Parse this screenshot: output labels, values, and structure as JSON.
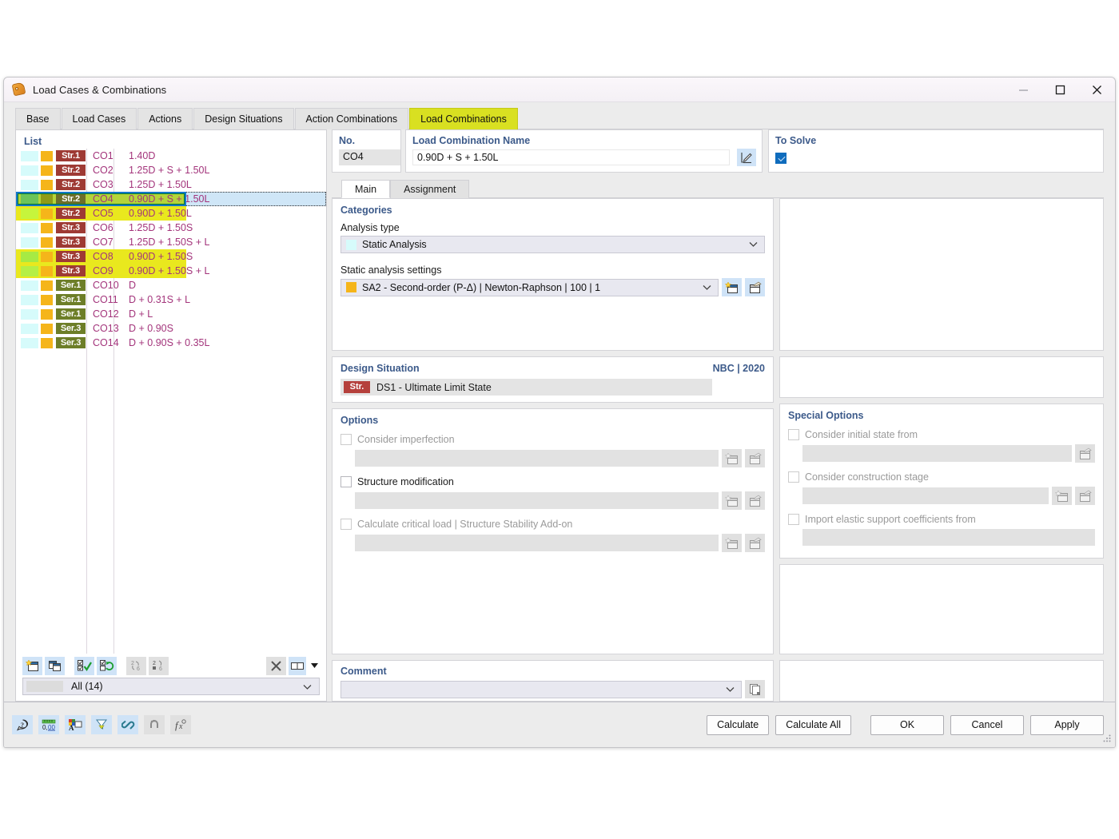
{
  "window": {
    "title": "Load Cases & Combinations",
    "icon": "load-tag-icon",
    "controls": {
      "minimize": "minimize-icon",
      "maximize": "maximize-icon",
      "close": "close-icon"
    }
  },
  "tabs": [
    {
      "label": "Base",
      "active": false
    },
    {
      "label": "Load Cases",
      "active": false
    },
    {
      "label": "Actions",
      "active": false
    },
    {
      "label": "Design Situations",
      "active": false
    },
    {
      "label": "Action Combinations",
      "active": false
    },
    {
      "label": "Load Combinations",
      "active": true
    }
  ],
  "list": {
    "title": "List",
    "rows": [
      {
        "sw1": "#d6fbfb",
        "sw2": "#f5b51a",
        "badge": "Str.1",
        "badge_bg": "#9e3a34",
        "no": "CO1",
        "desc": "1.40D",
        "hl": "none"
      },
      {
        "sw1": "#d6fbfb",
        "sw2": "#f5b51a",
        "badge": "Str.2",
        "badge_bg": "#9e3a34",
        "no": "CO2",
        "desc": "1.25D + S + 1.50L",
        "hl": "none"
      },
      {
        "sw1": "#d6fbfb",
        "sw2": "#f5b51a",
        "badge": "Str.2",
        "badge_bg": "#9e3a34",
        "no": "CO3",
        "desc": "1.25D + 1.50L",
        "hl": "none"
      },
      {
        "sw1": "#6cc45a",
        "sw2": "#8f9b18",
        "badge": "Str.2",
        "badge_bg": "#6d6e2a",
        "no": "CO4",
        "desc": "0.90D + S + 1.50L",
        "hl": "#b4d43a",
        "selected": true
      },
      {
        "sw1": "#c6f53c",
        "sw2": "#f5b51a",
        "badge": "Str.2",
        "badge_bg": "#9e3a34",
        "no": "CO5",
        "desc": "0.90D + 1.50L",
        "hl": "#e9e81e"
      },
      {
        "sw1": "#d6fbfb",
        "sw2": "#f5b51a",
        "badge": "Str.3",
        "badge_bg": "#9e3a34",
        "no": "CO6",
        "desc": "1.25D + 1.50S",
        "hl": "none"
      },
      {
        "sw1": "#d6fbfb",
        "sw2": "#f5b51a",
        "badge": "Str.3",
        "badge_bg": "#9e3a34",
        "no": "CO7",
        "desc": "1.25D + 1.50S + L",
        "hl": "none"
      },
      {
        "sw1": "#a6ea44",
        "sw2": "#f5b51a",
        "badge": "Str.3",
        "badge_bg": "#9e3a34",
        "no": "CO8",
        "desc": "0.90D + 1.50S",
        "hl": "#e9e81e"
      },
      {
        "sw1": "#b5ef46",
        "sw2": "#f5b51a",
        "badge": "Str.3",
        "badge_bg": "#9e3a34",
        "no": "CO9",
        "desc": "0.90D + 1.50S + L",
        "hl": "#e9e81e"
      },
      {
        "sw1": "#d6fbfb",
        "sw2": "#f5b51a",
        "badge": "Ser.1",
        "badge_bg": "#6d7e28",
        "no": "CO10",
        "desc": "D",
        "hl": "none"
      },
      {
        "sw1": "#d6fbfb",
        "sw2": "#f5b51a",
        "badge": "Ser.1",
        "badge_bg": "#6d7e28",
        "no": "CO11",
        "desc": "D + 0.31S + L",
        "hl": "none"
      },
      {
        "sw1": "#d6fbfb",
        "sw2": "#f5b51a",
        "badge": "Ser.1",
        "badge_bg": "#6d7e28",
        "no": "CO12",
        "desc": "D + L",
        "hl": "none"
      },
      {
        "sw1": "#d6fbfb",
        "sw2": "#f5b51a",
        "badge": "Ser.3",
        "badge_bg": "#6d7e28",
        "no": "CO13",
        "desc": "D + 0.90S",
        "hl": "none"
      },
      {
        "sw1": "#d6fbfb",
        "sw2": "#f5b51a",
        "badge": "Ser.3",
        "badge_bg": "#6d7e28",
        "no": "CO14",
        "desc": "D + 0.90S + 0.35L",
        "hl": "none"
      }
    ],
    "toolbar": [
      {
        "name": "new-load-combination-button",
        "icon": "new-window-star-icon",
        "enabled": true
      },
      {
        "name": "copy-load-combination-button",
        "icon": "copy-window-icon",
        "enabled": true
      },
      {
        "name": "select-all-button",
        "icon": "checkbox-check-icon",
        "enabled": true
      },
      {
        "name": "invert-selection-button",
        "icon": "checkbox-refresh-icon",
        "enabled": true
      },
      {
        "name": "renumber-button",
        "icon": "renumber-icon",
        "enabled": false
      },
      {
        "name": "sort-button",
        "icon": "sort-numeric-icon",
        "enabled": false
      }
    ],
    "toolbar_right": [
      {
        "name": "delete-button",
        "icon": "x-icon",
        "enabled": false
      },
      {
        "name": "view-mode-button",
        "icon": "split-view-icon",
        "enabled": true
      }
    ],
    "filter": {
      "label": "All (14)",
      "chevron": "chevron-down-icon"
    }
  },
  "header": {
    "no": {
      "label": "No.",
      "value": "CO4"
    },
    "name": {
      "label": "Load Combination Name",
      "value": "0.90D + S + 1.50L",
      "edit_icon": "edit-pencil-icon"
    },
    "to_solve": {
      "label": "To Solve",
      "checked": true
    }
  },
  "inner_tabs": [
    {
      "label": "Main",
      "active": true
    },
    {
      "label": "Assignment",
      "active": false
    }
  ],
  "main": {
    "categories": {
      "title": "Categories",
      "analysis_type": {
        "label": "Analysis type",
        "value": "Static Analysis",
        "swatch": "#d6fbfb",
        "chevron": "chevron-down-icon"
      },
      "static_analysis_settings": {
        "label": "Static analysis settings",
        "value": "SA2 - Second-order (P-Δ) | Newton-Raphson | 100 | 1",
        "swatch": "#f5b51a",
        "chevron": "chevron-down-icon",
        "new_button": "new-window-star-icon",
        "edit_button": "edit-window-icon"
      }
    },
    "design_situation": {
      "title": "Design Situation",
      "standard": "NBC | 2020",
      "badge": "Str.",
      "value": "DS1 - Ultimate Limit State"
    },
    "options": {
      "title": "Options",
      "items": [
        {
          "label": "Consider imperfection",
          "checked": false,
          "disabled": true,
          "field": "",
          "buttons": [
            "new-window-star-icon",
            "edit-window-icon"
          ]
        },
        {
          "label": "Structure modification",
          "checked": false,
          "disabled": false,
          "field": "",
          "buttons": [
            "new-window-star-icon",
            "edit-window-icon"
          ]
        },
        {
          "label": "Calculate critical load | Structure Stability Add-on",
          "checked": false,
          "disabled": true,
          "field": "",
          "buttons": [
            "new-window-star-icon",
            "edit-window-icon"
          ]
        }
      ]
    },
    "comment": {
      "title": "Comment",
      "value": "",
      "chevron": "chevron-down-icon",
      "copy_button": "copy-pages-icon"
    }
  },
  "special_options": {
    "title": "Special Options",
    "items": [
      {
        "label": "Consider initial state from",
        "checked": false,
        "disabled": true,
        "field": "",
        "buttons": [
          "edit-window-icon"
        ]
      },
      {
        "label": "Consider construction stage",
        "checked": false,
        "disabled": true,
        "field": "",
        "buttons": [
          "new-window-star-icon",
          "edit-window-icon"
        ]
      },
      {
        "label": "Import elastic support coefficients from",
        "checked": false,
        "disabled": true,
        "field": "",
        "buttons": []
      }
    ]
  },
  "footer": {
    "tools": [
      {
        "name": "help-button",
        "icon": "help-bubble-icon",
        "enabled": true
      },
      {
        "name": "units-button",
        "icon": "units-ruler-icon",
        "enabled": true
      },
      {
        "name": "colors-button",
        "icon": "colors-palette-icon",
        "enabled": true
      },
      {
        "name": "filter-button",
        "icon": "funnel-icon",
        "enabled": true
      },
      {
        "name": "link-button",
        "icon": "link-chain-icon",
        "enabled": true
      },
      {
        "name": "snap-button",
        "icon": "snap-magnet-icon",
        "enabled": false
      },
      {
        "name": "formula-button",
        "icon": "formula-fx-icon",
        "enabled": false
      }
    ],
    "buttons": [
      {
        "label": "Calculate",
        "name": "calculate-button"
      },
      {
        "label": "Calculate All",
        "name": "calculate-all-button"
      },
      {
        "label": "OK",
        "name": "ok-button"
      },
      {
        "label": "Cancel",
        "name": "cancel-button"
      },
      {
        "label": "Apply",
        "name": "apply-button"
      }
    ]
  }
}
